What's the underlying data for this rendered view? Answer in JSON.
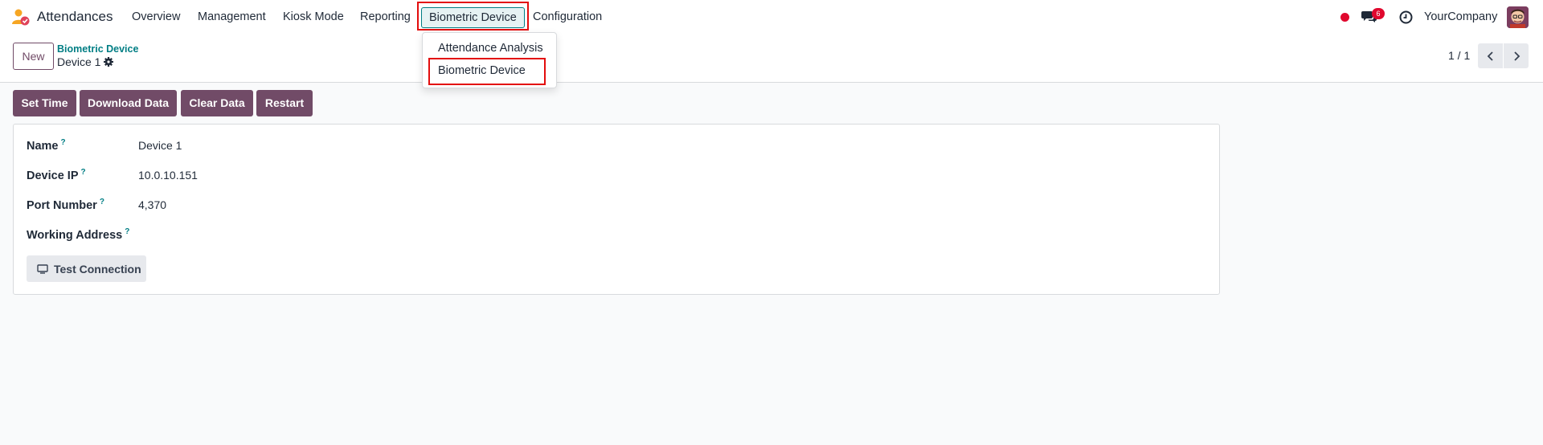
{
  "navbar": {
    "app_name": "Attendances",
    "menu": [
      "Overview",
      "Management",
      "Kiosk Mode",
      "Reporting",
      "Biometric Device",
      "Configuration"
    ],
    "chat_count": "6",
    "company": "YourCompany"
  },
  "dropdown": {
    "items": [
      "Attendance Analysis",
      "Biometric Device"
    ]
  },
  "control_panel": {
    "new_label": "New",
    "breadcrumb": "Biometric Device",
    "record_title": "Device 1",
    "pager": "1 / 1"
  },
  "actions": [
    "Set Time",
    "Download Data",
    "Clear Data",
    "Restart"
  ],
  "form": {
    "fields": [
      {
        "label": "Name",
        "value": "Device 1"
      },
      {
        "label": "Device IP",
        "value": "10.0.10.151"
      },
      {
        "label": "Port Number",
        "value": "4,370"
      },
      {
        "label": "Working Address",
        "value": ""
      }
    ],
    "help_mark": "?",
    "test_button": "Test Connection"
  },
  "colors": {
    "primary": "#714b67",
    "link": "#017e84",
    "highlight": "#e30d0d",
    "badge": "#e0082e"
  },
  "icons": [
    "attendance-app-logo-icon",
    "red-dot-icon",
    "chat-icon",
    "clock-icon",
    "gear-icon",
    "chevron-left-icon",
    "chevron-right-icon",
    "monitor-icon"
  ]
}
